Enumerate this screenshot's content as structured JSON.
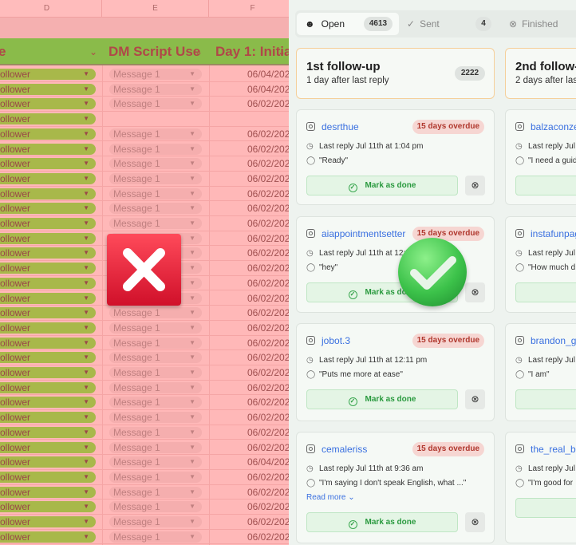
{
  "sheet": {
    "columns": [
      "D",
      "E",
      "F"
    ],
    "headers": [
      "e",
      "DM Script Use",
      "Day 1: Initia"
    ],
    "rows": [
      {
        "status": "ollower",
        "msg": "Message 1",
        "date": "06/04/202"
      },
      {
        "status": "ollower",
        "msg": "Message 1",
        "date": "06/04/202"
      },
      {
        "status": "ollower",
        "msg": "Message 1",
        "date": "06/02/202"
      },
      {
        "status": "ollower",
        "msg": "",
        "date": ""
      },
      {
        "status": "ollower",
        "msg": "Message 1",
        "date": "06/02/202"
      },
      {
        "status": "ollower",
        "msg": "Message 1",
        "date": "06/02/202"
      },
      {
        "status": "ollower",
        "msg": "Message 1",
        "date": "06/02/202"
      },
      {
        "status": "ollower",
        "msg": "Message 1",
        "date": "06/02/202"
      },
      {
        "status": "ollower",
        "msg": "Message 1",
        "date": "06/02/202"
      },
      {
        "status": "ollower",
        "msg": "Message 1",
        "date": "06/02/202"
      },
      {
        "status": "ollower",
        "msg": "Message 1",
        "date": "06/02/202"
      },
      {
        "status": "ollower",
        "msg": "Message 1",
        "date": "06/02/202"
      },
      {
        "status": "ollower",
        "msg": "Message 1",
        "date": "06/02/202"
      },
      {
        "status": "ollower",
        "msg": "Message 1",
        "date": "06/02/202"
      },
      {
        "status": "ollower",
        "msg": "Message 1",
        "date": "06/02/202"
      },
      {
        "status": "ollower",
        "msg": "Message 1",
        "date": "06/02/202"
      },
      {
        "status": "ollower",
        "msg": "Message 1",
        "date": "06/02/202"
      },
      {
        "status": "ollower",
        "msg": "Message 1",
        "date": "06/02/202"
      },
      {
        "status": "ollower",
        "msg": "Message 1",
        "date": "06/02/202"
      },
      {
        "status": "ollower",
        "msg": "Message 1",
        "date": "06/02/202"
      },
      {
        "status": "ollower",
        "msg": "Message 1",
        "date": "06/02/202"
      },
      {
        "status": "ollower",
        "msg": "Message 1",
        "date": "06/02/202"
      },
      {
        "status": "ollower",
        "msg": "Message 1",
        "date": "06/02/202"
      },
      {
        "status": "ollower",
        "msg": "Message 1",
        "date": "06/02/202"
      },
      {
        "status": "ollower",
        "msg": "Message 1",
        "date": "06/02/202"
      },
      {
        "status": "ollower",
        "msg": "Message 1",
        "date": "06/02/202"
      },
      {
        "status": "ollower",
        "msg": "Message 1",
        "date": "06/04/202"
      },
      {
        "status": "ollower",
        "msg": "Message 1",
        "date": "06/02/202"
      },
      {
        "status": "ollower",
        "msg": "Message 1",
        "date": "06/02/202"
      },
      {
        "status": "ollower",
        "msg": "Message 1",
        "date": "06/02/202"
      },
      {
        "status": "ollower",
        "msg": "Message 1",
        "date": "06/02/202"
      },
      {
        "status": "ollower",
        "msg": "Message 1",
        "date": "06/02/202"
      }
    ]
  },
  "app": {
    "tabs": [
      {
        "label": "Open",
        "count": "4613"
      },
      {
        "label": "Sent",
        "count": "4"
      },
      {
        "label": "Finished"
      }
    ],
    "columns": [
      {
        "title": "1st follow-up",
        "subtitle": "1 day after last reply",
        "count": "2222",
        "cards": [
          {
            "user": "desrthue",
            "badge": "15 days overdue",
            "last": "Last reply Jul 11th at 1:04 pm",
            "quote": "\"Ready\"",
            "action": "Mark as done"
          },
          {
            "user": "aiappointmentsetter",
            "badge": "15 days overdue",
            "last": "Last reply Jul 11th at 12:5",
            "quote": "\"hey\"",
            "action": "Mark as done"
          },
          {
            "user": "jobot.3",
            "badge": "15 days overdue",
            "last": "Last reply Jul 11th at 12:11 pm",
            "quote": "\"Puts me more at ease\"",
            "action": "Mark as done"
          },
          {
            "user": "cemaleriss",
            "badge": "15 days overdue",
            "last": "Last reply Jul 11th at 9:36 am",
            "quote": "\"I'm saying I don't speak English, what ...\"",
            "more": "Read more",
            "action": "Mark as done"
          }
        ]
      },
      {
        "title": "2nd follow-",
        "subtitle": "2 days after las",
        "cards": [
          {
            "user": "balzaconze",
            "last": "Last reply Jul",
            "quote": "\"I need a guid"
          },
          {
            "user": "instafunpag",
            "last": "Last reply Jul",
            "quote": "\"How much d"
          },
          {
            "user": "brandon_ga",
            "last": "Last reply Jul",
            "quote": "\"I am\""
          },
          {
            "user": "the_real_bo",
            "last": "Last reply Jul",
            "quote": "\"I'm good for"
          }
        ]
      }
    ]
  }
}
